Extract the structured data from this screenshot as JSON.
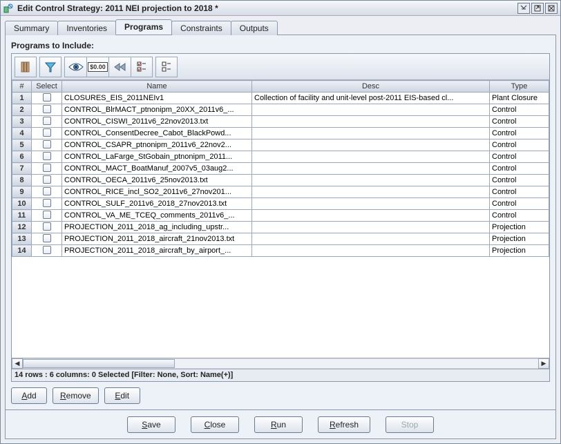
{
  "window": {
    "title": "Edit Control Strategy: 2011 NEI projection to 2018 *"
  },
  "tabs": [
    {
      "label": "Summary"
    },
    {
      "label": "Inventories"
    },
    {
      "label": "Programs"
    },
    {
      "label": "Constraints"
    },
    {
      "label": "Outputs"
    }
  ],
  "active_tab": "Programs",
  "section_label": "Programs to Include:",
  "toolbar_icons": [
    "columns-icon",
    "filter-icon",
    "eye-icon",
    "currency-icon",
    "rewind-icon",
    "checklist-icon",
    "checklist-clear-icon"
  ],
  "columns": [
    {
      "key": "num",
      "label": "#"
    },
    {
      "key": "select",
      "label": "Select"
    },
    {
      "key": "name",
      "label": "Name"
    },
    {
      "key": "desc",
      "label": "Desc"
    },
    {
      "key": "type",
      "label": "Type"
    }
  ],
  "rows": [
    {
      "num": "1",
      "name": "CLOSURES_EIS_2011NEIv1",
      "desc": "Collection of facility and unit-level post-2011 EIS-based cl...",
      "type": "Plant Closure"
    },
    {
      "num": "2",
      "name": "CONTROL_BlrMACT_ptnonipm_20XX_2011v6_...",
      "desc": "",
      "type": "Control"
    },
    {
      "num": "3",
      "name": "CONTROL_CISWI_2011v6_22nov2013.txt",
      "desc": "",
      "type": "Control"
    },
    {
      "num": "4",
      "name": "CONTROL_ConsentDecree_Cabot_BlackPowd...",
      "desc": "",
      "type": "Control"
    },
    {
      "num": "5",
      "name": "CONTROL_CSAPR_ptnonipm_2011v6_22nov2...",
      "desc": "",
      "type": "Control"
    },
    {
      "num": "6",
      "name": "CONTROL_LaFarge_StGobain_ptnonipm_2011...",
      "desc": "",
      "type": "Control"
    },
    {
      "num": "7",
      "name": "CONTROL_MACT_BoatManuf_2007v5_03aug2...",
      "desc": "",
      "type": "Control"
    },
    {
      "num": "8",
      "name": "CONTROL_OECA_2011v6_25nov2013.txt",
      "desc": "",
      "type": "Control"
    },
    {
      "num": "9",
      "name": "CONTROL_RICE_incl_SO2_2011v6_27nov201...",
      "desc": "",
      "type": "Control"
    },
    {
      "num": "10",
      "name": "CONTROL_SULF_2011v6_2018_27nov2013.txt",
      "desc": "",
      "type": "Control"
    },
    {
      "num": "11",
      "name": "CONTROL_VA_ME_TCEQ_comments_2011v6_...",
      "desc": "",
      "type": "Control"
    },
    {
      "num": "12",
      "name": "PROJECTION_2011_2018_ag_including_upstr...",
      "desc": "",
      "type": "Projection"
    },
    {
      "num": "13",
      "name": "PROJECTION_2011_2018_aircraft_21nov2013.txt",
      "desc": "",
      "type": "Projection"
    },
    {
      "num": "14",
      "name": "PROJECTION_2011_2018_aircraft_by_airport_...",
      "desc": "",
      "type": "Projection"
    }
  ],
  "status": "14 rows : 6 columns: 0 Selected [Filter: None, Sort: Name(+)]",
  "row_buttons": {
    "add": "Add",
    "remove": "Remove",
    "edit": "Edit"
  },
  "bottom_buttons": {
    "save": "Save",
    "close": "Close",
    "run": "Run",
    "refresh": "Refresh",
    "stop": "Stop"
  }
}
